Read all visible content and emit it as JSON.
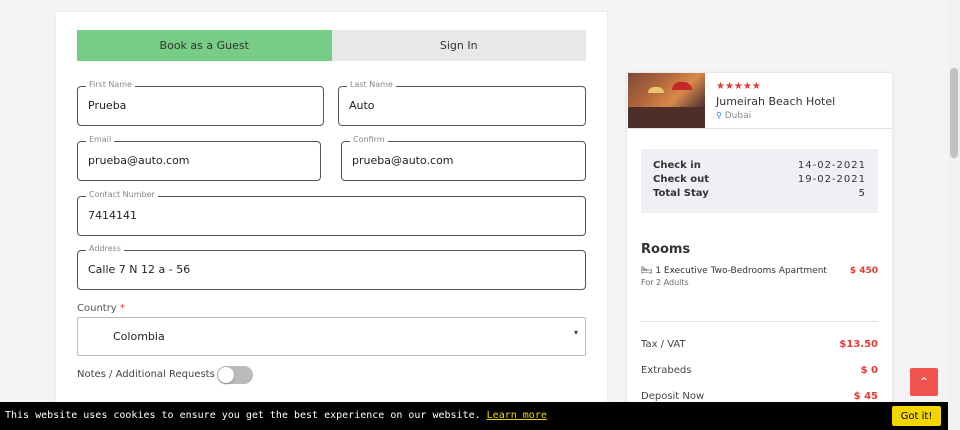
{
  "tabs": {
    "guest": "Book as a Guest",
    "signin": "Sign In"
  },
  "form": {
    "first_name": {
      "label": "First Name",
      "value": "Prueba"
    },
    "last_name": {
      "label": "Last Name",
      "value": "Auto"
    },
    "email": {
      "label": "Email",
      "value": "prueba@auto.com"
    },
    "confirm": {
      "label": "Confirm",
      "value": "prueba@auto.com"
    },
    "contact": {
      "label": "Contact Number",
      "value": "7414141"
    },
    "address": {
      "label": "Address",
      "value": "Calle 7 N 12 a - 56"
    },
    "country": {
      "label": "Country",
      "required_mark": "*",
      "value": "Colombia",
      "caret": "▾"
    },
    "notes": {
      "label": "Notes / Additional Requests",
      "enabled": false
    }
  },
  "hotel": {
    "stars": "★★★★★",
    "name": "Jumeirah Beach Hotel",
    "pin": "⚲",
    "location": "Dubai"
  },
  "stay": {
    "checkin_label": "Check in",
    "checkin_value": "14-02-2021",
    "checkout_label": "Check out",
    "checkout_value": "19-02-2021",
    "total_label": "Total Stay",
    "total_value": "5"
  },
  "rooms": {
    "title": "Rooms",
    "bed_icon": "🛏",
    "item": "1 Executive Two-Bedrooms Apartment",
    "price": "$ 450",
    "sub": "For 2 Adults"
  },
  "costs": {
    "tax_label": "Tax / VAT",
    "tax_value": "$13.50",
    "extrabeds_label": "Extrabeds",
    "extrabeds_value": "$ 0",
    "deposit_label": "Deposit Now",
    "deposit_value": "$ 45"
  },
  "to_top_icon": "⌃",
  "cookie": {
    "text": "This website uses cookies to ensure you get the best experience on our website.",
    "link": "Learn more",
    "button": "Got it!"
  },
  "colors": {
    "accent_green": "#77cc86",
    "price_red": "#e53935",
    "cookie_yellow": "#f1d600",
    "to_top": "#f0544f"
  }
}
